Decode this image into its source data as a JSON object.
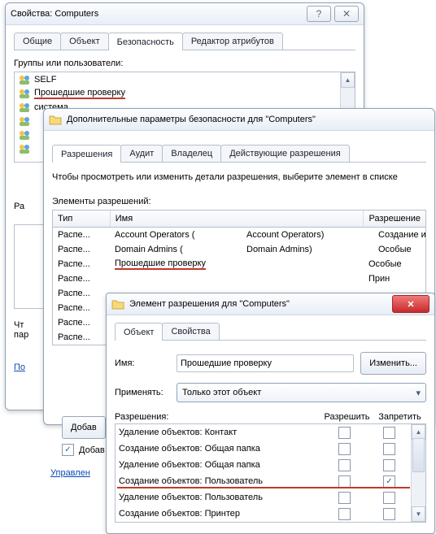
{
  "win1": {
    "title": "Свойства: Computers",
    "tabs": [
      "Общие",
      "Объект",
      "Безопасность",
      "Редактор атрибутов"
    ],
    "active_tab": 2,
    "groups_label": "Группы или пользователи:",
    "list": [
      "SELF",
      "Прошедшие проверку",
      "система",
      ""
    ],
    "perm_label_prefix": "Ра",
    "trunc_lines": [
      "Чт",
      "пар"
    ],
    "link_prefix": "По",
    "add_btn": "Добав",
    "add_chk_label": "Добав",
    "manage_link": "Управлен"
  },
  "win2": {
    "title": "Дополнительные параметры безопасности  для \"Computers\"",
    "tabs": [
      "Разрешения",
      "Аудит",
      "Владелец",
      "Действующие разрешения"
    ],
    "active_tab": 0,
    "hint": "Чтобы просмотреть или изменить детали разрешения, выберите элемент в списке",
    "elements_label": "Элементы разрешений:",
    "headers": {
      "type": "Тип",
      "name": "Имя",
      "perm": "Разрешение"
    },
    "rows": [
      {
        "type": "Распе...",
        "name": "Account Operators (",
        "extra": "Account Operators)",
        "perm": "Создание или"
      },
      {
        "type": "Распе...",
        "name": "Domain Admins (",
        "extra": "Domain Admins)",
        "perm": "Особые"
      },
      {
        "type": "Распе...",
        "name": "Прошедшие проверку",
        "extra": "",
        "perm": "Особые"
      },
      {
        "type": "Распе...",
        "name": "",
        "extra": "",
        "perm": "Прин"
      },
      {
        "type": "Распе...",
        "name": "",
        "extra": "",
        "perm": ""
      },
      {
        "type": "Распе...",
        "name": "",
        "extra": "",
        "perm": ""
      },
      {
        "type": "Распе...",
        "name": "",
        "extra": "",
        "perm": ""
      },
      {
        "type": "Распе...",
        "name": "",
        "extra": "",
        "perm": ""
      }
    ]
  },
  "win3": {
    "title": "Элемент разрешения для \"Computers\"",
    "tabs": [
      "Объект",
      "Свойства"
    ],
    "active_tab": 0,
    "name_label": "Имя:",
    "name_value": "Прошедшие проверку",
    "change_btn": "Изменить...",
    "apply_label": "Применять:",
    "apply_value": "Только этот объект",
    "perm_header": "Разрешения:",
    "allow_header": "Разрешить",
    "deny_header": "Запретить",
    "perms": [
      {
        "label": "Удаление объектов: Контакт",
        "allow": false,
        "deny": false
      },
      {
        "label": "Создание объектов: Общая папка",
        "allow": false,
        "deny": false
      },
      {
        "label": "Удаление объектов: Общая папка",
        "allow": false,
        "deny": false
      },
      {
        "label": "Создание объектов: Пользователь",
        "allow": false,
        "deny": true
      },
      {
        "label": "Удаление объектов: Пользователь",
        "allow": false,
        "deny": false
      },
      {
        "label": "Создание объектов: Принтер",
        "allow": false,
        "deny": false
      }
    ]
  }
}
